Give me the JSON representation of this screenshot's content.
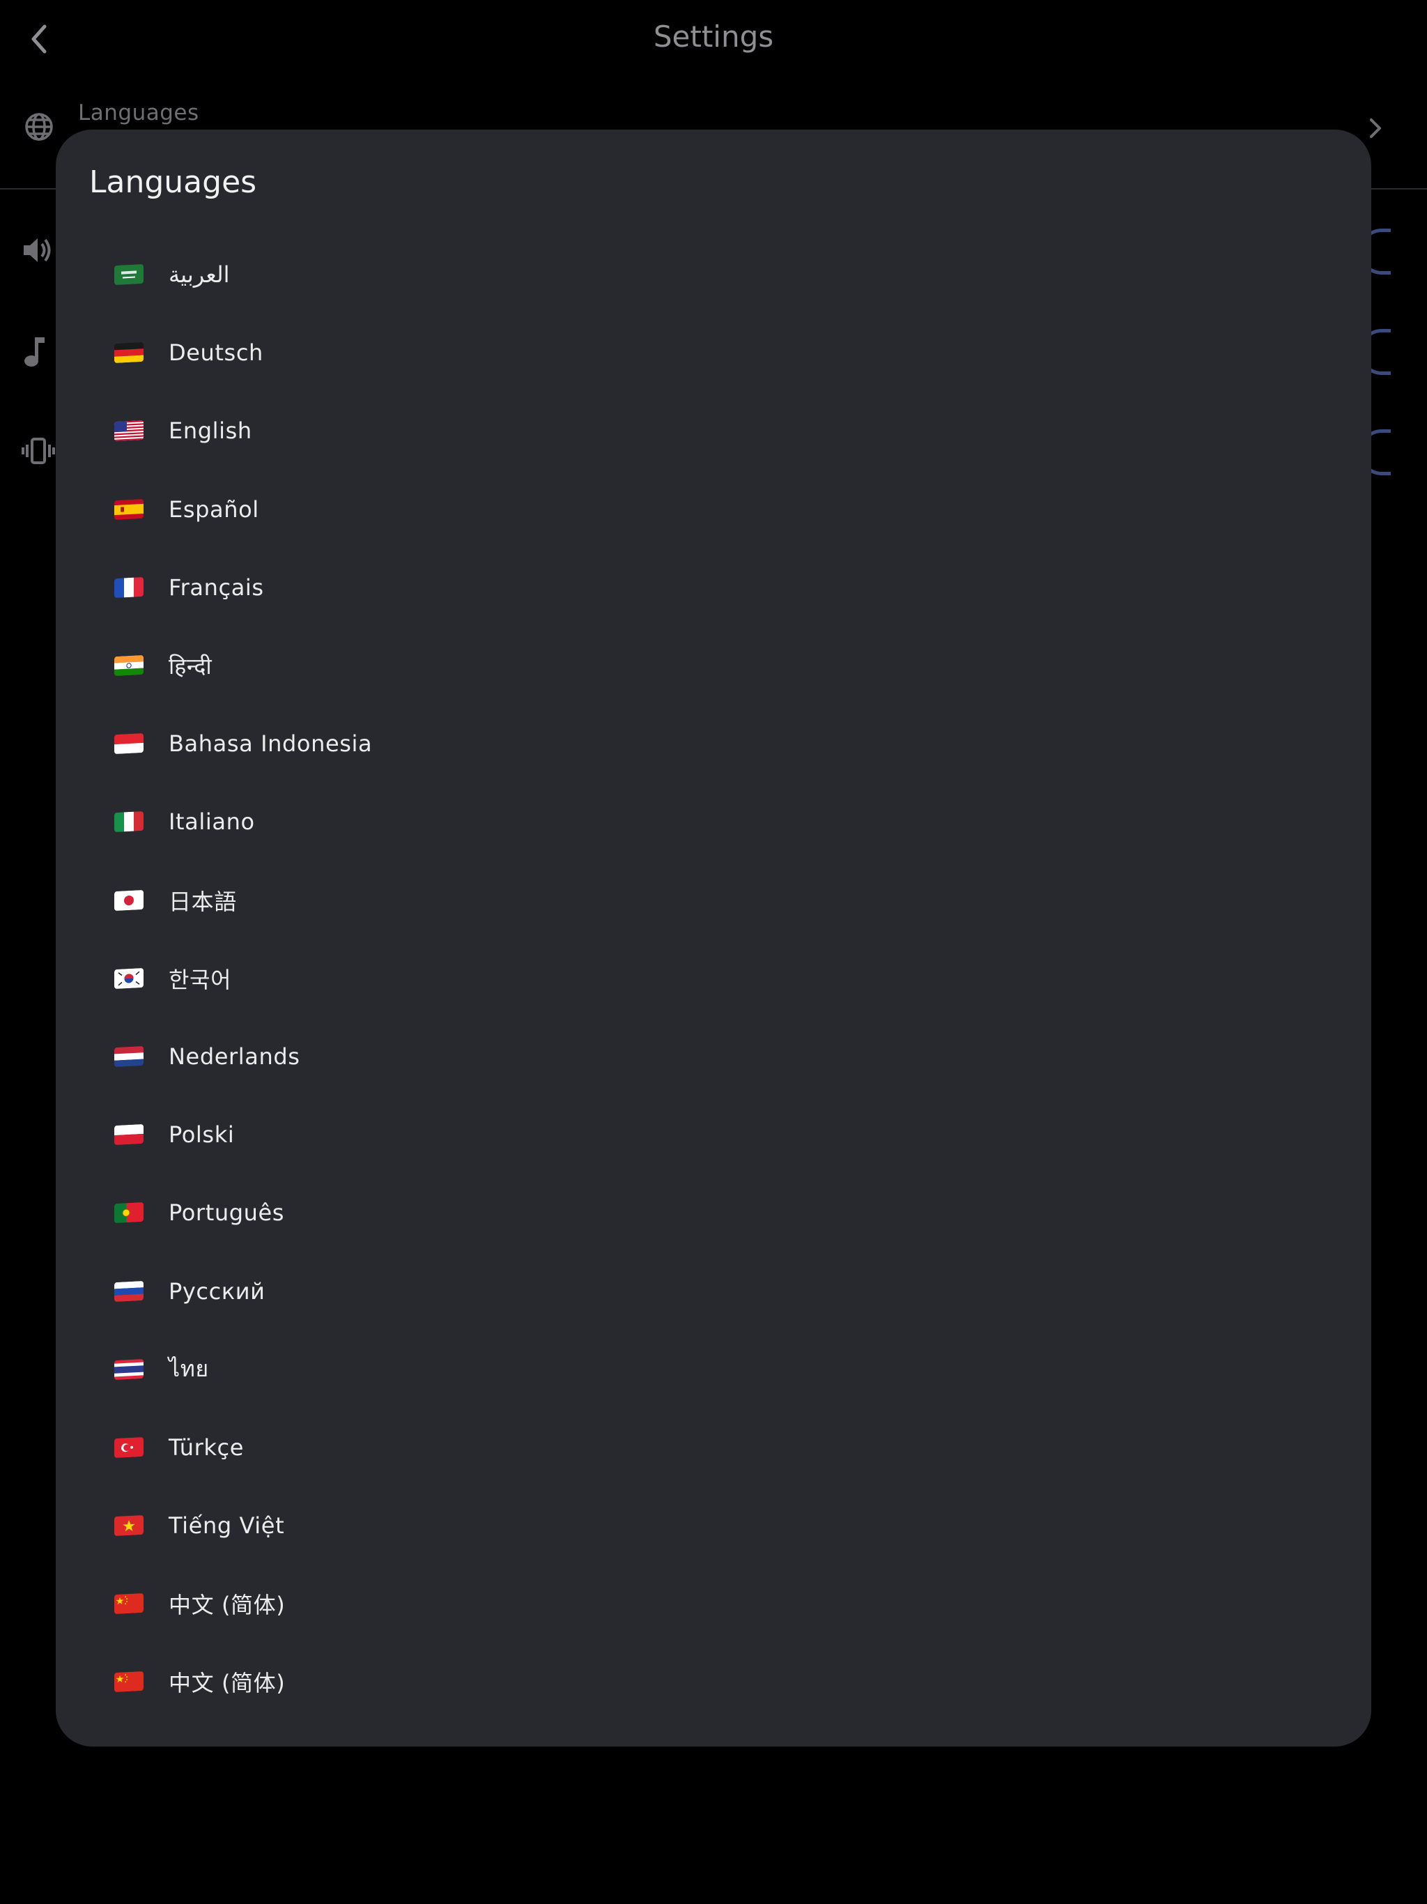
{
  "header": {
    "title": "Settings"
  },
  "settings_row": {
    "label": "Languages"
  },
  "sheet": {
    "title": "Languages"
  },
  "languages": [
    {
      "label": "العربية",
      "flag": "saudi-arabia-flag-icon"
    },
    {
      "label": "Deutsch",
      "flag": "germany-flag-icon"
    },
    {
      "label": "English",
      "flag": "usa-flag-icon"
    },
    {
      "label": "Español",
      "flag": "spain-flag-icon"
    },
    {
      "label": "Français",
      "flag": "france-flag-icon"
    },
    {
      "label": "हिन्दी",
      "flag": "india-flag-icon"
    },
    {
      "label": "Bahasa Indonesia",
      "flag": "indonesia-flag-icon"
    },
    {
      "label": "Italiano",
      "flag": "italy-flag-icon"
    },
    {
      "label": "日本語",
      "flag": "japan-flag-icon"
    },
    {
      "label": "한국어",
      "flag": "korea-flag-icon"
    },
    {
      "label": "Nederlands",
      "flag": "netherlands-flag-icon"
    },
    {
      "label": "Polski",
      "flag": "poland-flag-icon"
    },
    {
      "label": "Português",
      "flag": "portugal-flag-icon"
    },
    {
      "label": "Русский",
      "flag": "russia-flag-icon"
    },
    {
      "label": "ไทย",
      "flag": "thailand-flag-icon"
    },
    {
      "label": "Türkçe",
      "flag": "turkey-flag-icon"
    },
    {
      "label": "Tiếng Việt",
      "flag": "vietnam-flag-icon"
    },
    {
      "label": "中文 (简体)",
      "flag": "china-flag-icon"
    },
    {
      "label": "中文 (简体)",
      "flag": "china-flag-icon"
    }
  ],
  "colors": {
    "background": "#000000",
    "sheet": "#28292e",
    "text": "#ececec",
    "muted": "#8e8e93",
    "toggle_accent": "#3a4a7a"
  }
}
